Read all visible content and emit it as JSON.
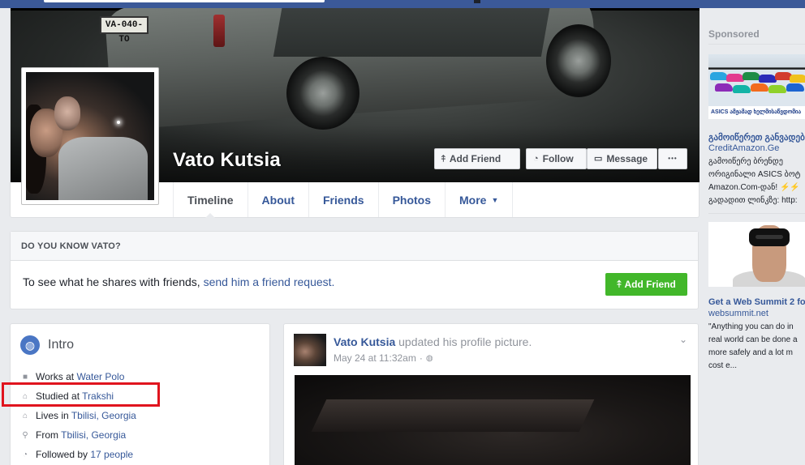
{
  "profile": {
    "name": "Vato Kutsia",
    "plate_text": "VA-040-TO"
  },
  "actions": {
    "add_friend": "Add Friend",
    "follow": "Follow",
    "message": "Message",
    "more_dots": "•••"
  },
  "tabs": [
    {
      "label": "Timeline"
    },
    {
      "label": "About"
    },
    {
      "label": "Friends"
    },
    {
      "label": "Photos"
    },
    {
      "label": "More"
    }
  ],
  "know": {
    "heading": "DO YOU KNOW VATO?",
    "text": "To see what he shares with friends, ",
    "link": "send him a friend request.",
    "button": "Add Friend"
  },
  "intro": {
    "title": "Intro",
    "rows": [
      {
        "prefix": "Works at ",
        "link": "Water Polo",
        "icon": "briefcase-icon"
      },
      {
        "prefix": "Studied at ",
        "link": "Trakshi",
        "icon": "graduation-cap-icon"
      },
      {
        "prefix": "Lives in ",
        "link": "Tbilisi, Georgia",
        "icon": "home-icon"
      },
      {
        "prefix": "From ",
        "link": "Tbilisi, Georgia",
        "icon": "location-pin-icon"
      },
      {
        "prefix": "Followed by ",
        "link": "17 people",
        "icon": "rss-icon"
      }
    ]
  },
  "post": {
    "author": "Vato Kutsia",
    "action": " updated his profile picture.",
    "timestamp": "May 24 at 11:32am",
    "separator": "·"
  },
  "sidebar": {
    "sponsored": "Sponsored",
    "ad1": {
      "banner": "ASICS ამჟამად ხელმისაწვდომია",
      "title": "გამოიწერეთ განვადებ",
      "domain": "CreditAmazon.Ge",
      "body": [
        "გამოიწერე ბრენდე",
        "ორიგინალი ASICS ბოტ",
        "Amazon.Com-დან! ⚡⚡",
        "გადადით ლინკზე: http:"
      ]
    },
    "ad2": {
      "title": "Get a Web Summit 2 fo",
      "domain": "websummit.net",
      "body": [
        "\"Anything you can do in",
        "real world can be done a",
        "more safely and a lot m",
        "cost e..."
      ]
    }
  },
  "colors": {
    "brand_blue": "#3b5998",
    "link_blue": "#365899",
    "green": "#42b72a",
    "highlight_red": "#e0141e"
  }
}
